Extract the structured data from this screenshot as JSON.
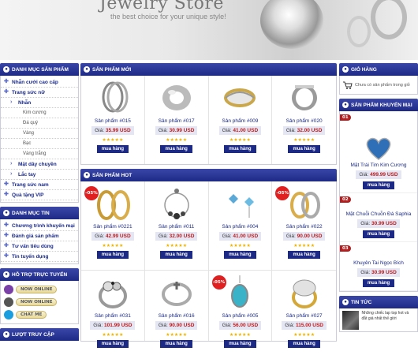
{
  "banner": {
    "title": "Jewelry Store",
    "slogan": "the best choice for your unique style!"
  },
  "left": {
    "categories_header": "DANH MỤC SẢN PHẨM",
    "categories": [
      {
        "label": "Nhẫn cưới cao cấp",
        "level": 1
      },
      {
        "label": "Trang sức nữ",
        "level": 1
      },
      {
        "label": "Nhẫn",
        "level": 2
      },
      {
        "label": "Kim cương",
        "level": 3
      },
      {
        "label": "Đá quý",
        "level": 3
      },
      {
        "label": "Vàng",
        "level": 3
      },
      {
        "label": "Bạc",
        "level": 3
      },
      {
        "label": "Vàng trắng",
        "level": 3
      },
      {
        "label": "Mặt dây chuyền",
        "level": 2
      },
      {
        "label": "Lắc tay",
        "level": 2
      },
      {
        "label": "Trang sức nam",
        "level": 1
      },
      {
        "label": "Quà tặng VIP",
        "level": 1
      }
    ],
    "news_header": "DANH MỤC TIN",
    "news_items": [
      "Chương trình khuyến mại",
      "Đánh giá sản phẩm",
      "Tư vấn tiêu dùng",
      "Tin tuyển dụng"
    ],
    "support_header": "HỖ TRỢ TRỰC TUYẾN",
    "support": [
      {
        "label": "NOW ONLINE",
        "icon": "yahoo-icon",
        "color": "#7b3fa8"
      },
      {
        "label": "NOW ONLINE",
        "icon": "yahoo-icon",
        "color": "#555555"
      },
      {
        "label": "CHAT ME",
        "icon": "skype-icon",
        "color": "#1a9ee0"
      }
    ],
    "visits_header": "LƯỢT TRUY CẬP"
  },
  "main": {
    "new_header": "SẢN PHẨM MỚI",
    "hot_header": "SẢN PHẨM HOT",
    "price_label": "Giá:",
    "buy_label": "mua hàng",
    "new_products": [
      {
        "name": "Sản phẩm #015",
        "price": "35.99 USD",
        "img": "hoop",
        "sale": ""
      },
      {
        "name": "Sản phẩm #017",
        "price": "30.99 USD",
        "img": "chunky",
        "sale": ""
      },
      {
        "name": "Sản phẩm #009",
        "price": "41.00 USD",
        "img": "goldband",
        "sale": ""
      },
      {
        "name": "Sản phẩm #020",
        "price": "32.00 USD",
        "img": "silverband",
        "sale": ""
      }
    ],
    "hot_products": [
      {
        "name": "Sản phẩm #0221",
        "price": "42.99 USD",
        "img": "goldhoops",
        "sale": "-05%"
      },
      {
        "name": "Sản phẩm #011",
        "price": "32.00 USD",
        "img": "beadhoop",
        "sale": ""
      },
      {
        "name": "Sản phẩm #004",
        "price": "41.00 USD",
        "img": "bluestud",
        "sale": ""
      },
      {
        "name": "Sản phẩm #022",
        "price": "90.00 USD",
        "img": "twotone",
        "sale": "-05%"
      },
      {
        "name": "Sản phẩm #031",
        "price": "101.99 USD",
        "img": "flowerring",
        "sale": ""
      },
      {
        "name": "Sản phẩm #016",
        "price": "90.00 USD",
        "img": "cross",
        "sale": ""
      },
      {
        "name": "Sản phẩm #005",
        "price": "56.00 USD",
        "img": "turq",
        "sale": "-05%"
      },
      {
        "name": "Sản phẩm #027",
        "price": "115.00 USD",
        "img": "goldring",
        "sale": ""
      }
    ]
  },
  "right": {
    "cart_header": "GIỎ HÀNG",
    "cart_text": "Chưa có sản phẩm trong giỏ",
    "promo_header": "SẢN PHẨM KHUYẾN MẠI",
    "promos": [
      {
        "tag": "01",
        "name": "Mặt Trái Tim Kim Cương",
        "price": "499.99 USD"
      },
      {
        "tag": "02",
        "name": "Mặt Chuỗi Chuỗn Đá Saphia",
        "price": "30.99 USD"
      },
      {
        "tag": "03",
        "name": "Khuyên Tai Ngọc Bích",
        "price": "30.99 USD"
      }
    ],
    "news_header": "TIN TỨC",
    "news_text": "Những chiếc lap top hot và đắt giá nhất thế giới"
  }
}
